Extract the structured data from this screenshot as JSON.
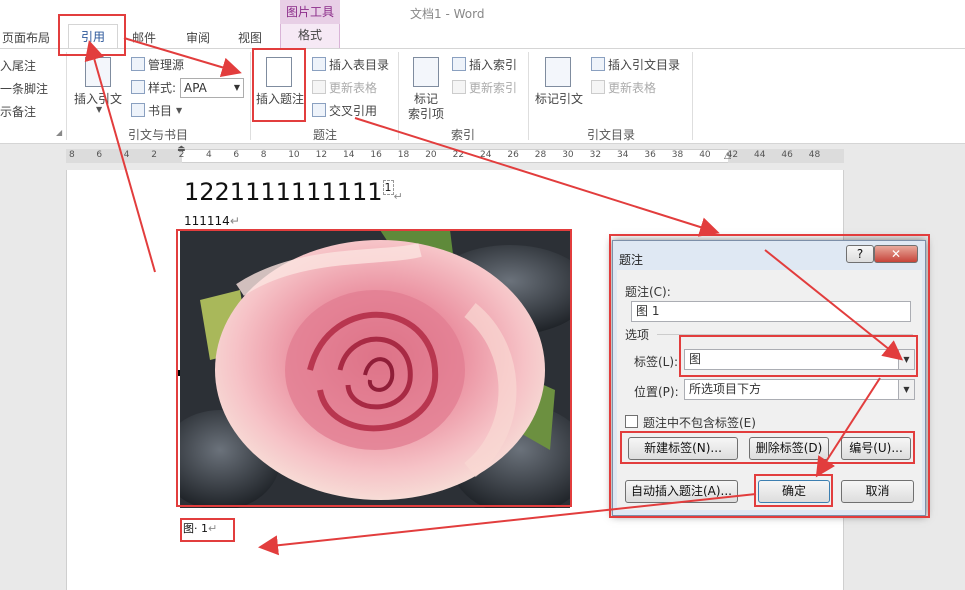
{
  "window": {
    "title": "文档1 - Word"
  },
  "ribbon_tabs": {
    "page_layout": "页面布局",
    "references": "引用",
    "mailings": "邮件",
    "review": "审阅",
    "view": "视图",
    "picture_tools": "图片工具",
    "format": "格式"
  },
  "ribbon": {
    "footnotes": {
      "endnote": "入尾注",
      "next_footnote": "一条脚注",
      "show_notes": "示备注"
    },
    "citations": {
      "insert_citation": "插入引文",
      "manage_sources": "管理源",
      "style_label": "样式:",
      "style_value": "APA",
      "bibliography": "书目",
      "group_label": "引文与书目"
    },
    "captions": {
      "insert_caption": "插入题注",
      "insert_table_of_figures": "插入表目录",
      "update_table": "更新表格",
      "cross_reference": "交叉引用",
      "group_label": "题注"
    },
    "index": {
      "mark_entry_line1": "标记",
      "mark_entry_line2": "索引项",
      "insert_index": "插入索引",
      "update_index": "更新索引",
      "group_label": "索引"
    },
    "toa": {
      "mark_citation": "标记引文",
      "insert_toa": "插入引文目录",
      "update_table": "更新表格",
      "group_label": "引文目录"
    }
  },
  "ruler": {
    "ticks": [
      "8",
      "6",
      "4",
      "2",
      "2",
      "4",
      "6",
      "8",
      "10",
      "12",
      "14",
      "16",
      "18",
      "20",
      "22",
      "24",
      "26",
      "28",
      "30",
      "32",
      "34",
      "36",
      "38",
      "40",
      "42",
      "44",
      "46",
      "48"
    ]
  },
  "document": {
    "heading": "1221111111111",
    "footnote_ref": "1",
    "line2": "111114",
    "caption": "图· 1"
  },
  "dialog": {
    "title": "题注",
    "help": "?",
    "close": "✕",
    "caption_label": "题注(C):",
    "caption_value": "图 1",
    "options_label": "选项",
    "label_label": "标签(L):",
    "label_value": "图",
    "position_label": "位置(P):",
    "position_value": "所选项目下方",
    "exclude_label": "题注中不包含标签(E)",
    "new_label_button": "新建标签(N)...",
    "delete_label_button": "删除标签(D)",
    "numbering_button": "编号(U)...",
    "autocaption_button": "自动插入题注(A)...",
    "ok_button": "确定",
    "cancel_button": "取消"
  },
  "colors": {
    "accent_red": "#e23d3d",
    "word_blue": "#2b579a",
    "picture_tools": "#8c2d8a"
  }
}
